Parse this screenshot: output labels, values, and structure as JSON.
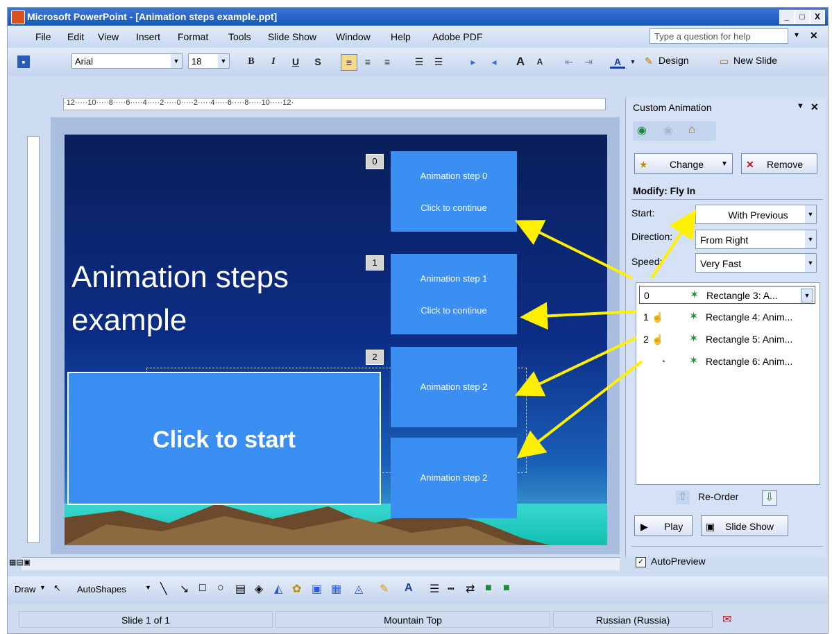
{
  "window": {
    "title": "Microsoft PowerPoint - [Animation steps example.ppt]",
    "minimize": "_",
    "maximize": "□",
    "close": "X"
  },
  "menu": [
    "File",
    "Edit",
    "View",
    "Insert",
    "Format",
    "Tools",
    "Slide Show",
    "Window",
    "Help",
    "Adobe PDF"
  ],
  "help_placeholder": "Type a question for help",
  "toolbar": {
    "font": "Arial",
    "size": "18",
    "bold": "B",
    "italic": "I",
    "underline": "U",
    "shadow": "S",
    "font_color": "A",
    "design": "Design",
    "new_slide": "New Slide"
  },
  "ruler_text": "·12·····10·····8·····6·····4·····2·····0·····2·····4·····6·····8·····10·····12·",
  "slide": {
    "title": "Animation steps example",
    "start_button": "Click to start",
    "steps": [
      {
        "badge": "0",
        "line1": "Animation step 0",
        "line2": "Click to continue"
      },
      {
        "badge": "1",
        "line1": "Animation step 1",
        "line2": "Click to continue"
      },
      {
        "badge": "2",
        "line1": "Animation step 2",
        "line2": ""
      },
      {
        "badge": "",
        "line1": "Animation step 2",
        "line2": ""
      }
    ]
  },
  "taskpane": {
    "title": "Custom Animation",
    "change": "Change",
    "remove": "Remove",
    "modify": "Modify: Fly In",
    "start_label": "Start:",
    "start_value": "With Previous",
    "direction_label": "Direction:",
    "direction_value": "From Right",
    "speed_label": "Speed:",
    "speed_value": "Very Fast",
    "items": [
      {
        "num": "0",
        "text": "Rectangle 3: A..."
      },
      {
        "num": "1",
        "text": "Rectangle 4: Anim..."
      },
      {
        "num": "2",
        "text": "Rectangle 5: Anim..."
      },
      {
        "num": "",
        "text": "Rectangle 6: Anim..."
      }
    ],
    "reorder": "Re-Order",
    "play": "Play",
    "slideshow": "Slide Show",
    "autopreview": "AutoPreview"
  },
  "drawbar": {
    "draw": "Draw",
    "autoshapes": "AutoShapes"
  },
  "status": {
    "slide": "Slide 1 of 1",
    "design": "Mountain Top",
    "language": "Russian (Russia)"
  }
}
